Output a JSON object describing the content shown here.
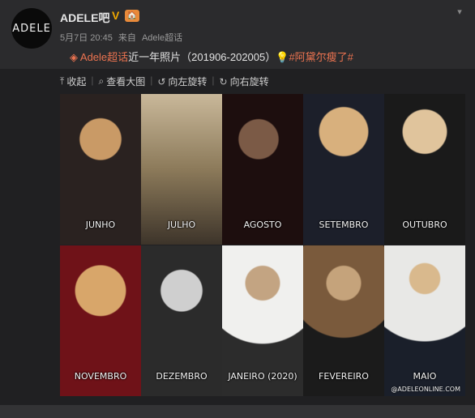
{
  "post": {
    "avatar_text": "ADELE",
    "username": "ADELE吧",
    "vip_badge": "V",
    "level_badge": "🏠",
    "timestamp": "5月7日 20:45",
    "source_prefix": "来自",
    "source": "Adele超话",
    "text": {
      "supertopic": "Adele超话",
      "body": "近一年照片（201906-202005）",
      "emoji": "💡",
      "hashtag": "#阿黛尔瘦了#"
    }
  },
  "toolbar": {
    "collapse": "收起",
    "view_large": "查看大图",
    "rotate_left": "向左旋转",
    "rotate_right": "向右旋转"
  },
  "photos": [
    {
      "label": "JUNHO"
    },
    {
      "label": "JULHO"
    },
    {
      "label": "AGOSTO"
    },
    {
      "label": "SETEMBRO"
    },
    {
      "label": "OUTUBRO"
    },
    {
      "label": "NOVEMBRO"
    },
    {
      "label": "DEZEMBRO"
    },
    {
      "label": "JANEIRO (2020)"
    },
    {
      "label": "FEVEREIRO"
    },
    {
      "label": "MAIO"
    }
  ],
  "watermark": "@ADELEONLINE.COM",
  "icons": {
    "menu": "chevron-down-icon",
    "collapse": "arrow-up-icon",
    "view_large": "magnifier-icon",
    "rotate_left": "rotate-left-icon",
    "rotate_right": "rotate-right-icon",
    "supertopic": "diamond-icon"
  },
  "colors": {
    "background": "#2b2b2d",
    "link": "#eb7350",
    "vip": "#f0a800"
  }
}
